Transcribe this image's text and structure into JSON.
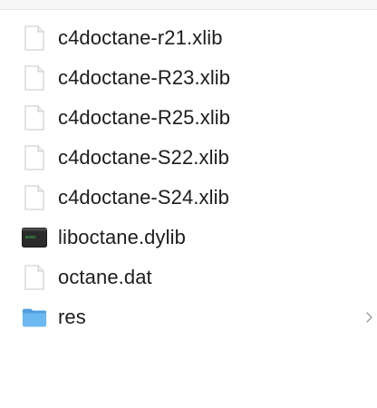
{
  "files": [
    {
      "name": "c4doctane-r21.xlib",
      "icon": "document-icon",
      "type": "file"
    },
    {
      "name": "c4doctane-R23.xlib",
      "icon": "document-icon",
      "type": "file"
    },
    {
      "name": "c4doctane-R25.xlib",
      "icon": "document-icon",
      "type": "file"
    },
    {
      "name": "c4doctane-S22.xlib",
      "icon": "document-icon",
      "type": "file"
    },
    {
      "name": "c4doctane-S24.xlib",
      "icon": "document-icon",
      "type": "file"
    },
    {
      "name": "liboctane.dylib",
      "icon": "terminal-exec-icon",
      "type": "executable"
    },
    {
      "name": "octane.dat",
      "icon": "document-icon",
      "type": "file"
    },
    {
      "name": "res",
      "icon": "folder-icon",
      "type": "folder"
    }
  ],
  "colors": {
    "text": "#1d1d1f",
    "folder": "#5aa9e6",
    "document_border": "#c8c8c8",
    "terminal_bg": "#2b2b2b",
    "terminal_text": "#39d353"
  }
}
